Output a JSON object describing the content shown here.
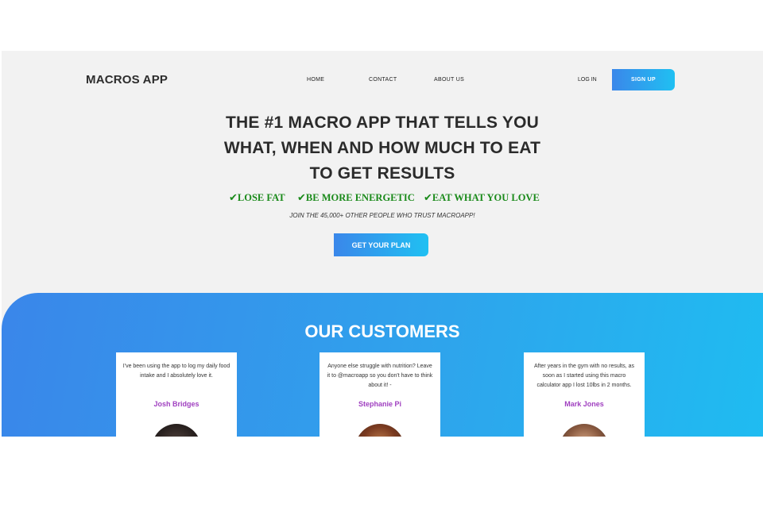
{
  "nav": {
    "logo": "MACROS APP",
    "links": [
      "HOME",
      "CONTACT",
      "ABOUT US"
    ],
    "login": "LOG IN",
    "signup": "SIGN UP"
  },
  "hero": {
    "headline": [
      "THE #1 MACRO APP THAT TELLS YOU",
      "WHAT, WHEN AND HOW MUCH TO EAT",
      "TO GET RESULTS"
    ],
    "benefits": [
      "LOSE FAT",
      "BE MORE ENERGETIC",
      "EAT WHAT YOU LOVE"
    ],
    "check_icon": "✔",
    "tagline": "JOIN THE 45,000+ OTHER PEOPLE WHO TRUST MACROAPP!",
    "cta": "GET YOUR PLAN"
  },
  "customers": {
    "title": "OUR CUSTOMERS",
    "testimonials": [
      {
        "quote": "I've been using the app to log my daily food intake and I absolutely love it.",
        "name": "Josh Bridges"
      },
      {
        "quote": "Anyone else struggle with nutrition? Leave it to @macroapp so you don't have to think about it! -",
        "name": "Stephanie Pi"
      },
      {
        "quote": "After years in the gym with no results, as soon as I started using this macro calculator app I lost 10lbs in 2 months.",
        "name": "Mark Jones"
      }
    ]
  },
  "colors": {
    "accent_start": "#3a87ea",
    "accent_end": "#20c0f2",
    "benefit_green": "#1a8a1a",
    "name_purple": "#a040c0"
  }
}
